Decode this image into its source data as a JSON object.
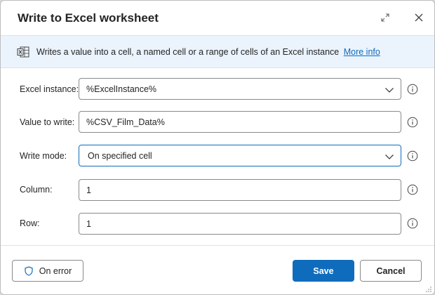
{
  "dialog": {
    "title": "Write to Excel worksheet"
  },
  "banner": {
    "text": "Writes a value into a cell, a named cell or a range of cells of an Excel instance",
    "link": "More info"
  },
  "fields": {
    "excel_instance": {
      "label": "Excel instance:",
      "value": "%ExcelInstance%"
    },
    "value_to_write": {
      "label": "Value to write:",
      "value": "%CSV_Film_Data%"
    },
    "write_mode": {
      "label": "Write mode:",
      "value": "On specified cell"
    },
    "column": {
      "label": "Column:",
      "value": "1"
    },
    "row": {
      "label": "Row:",
      "value": "1"
    }
  },
  "footer": {
    "on_error": "On error",
    "save": "Save",
    "cancel": "Cancel"
  },
  "colors": {
    "accent": "#0f6cbd",
    "banner_bg": "#ebf3fc"
  },
  "icons": [
    "expand-icon",
    "close-icon",
    "excel-icon",
    "chevron-down-icon",
    "info-icon",
    "shield-icon",
    "resize-grip-icon"
  ]
}
